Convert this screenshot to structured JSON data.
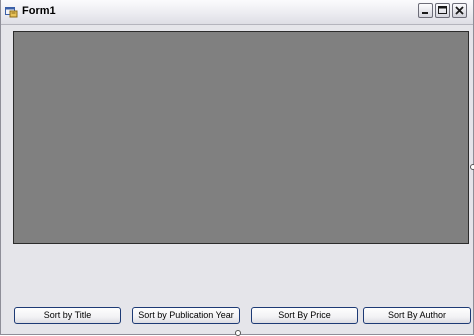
{
  "window": {
    "title": "Form1",
    "icons": {
      "app": "form-app-icon",
      "minimize": "minimize-icon",
      "maximize": "maximize-icon",
      "close": "close-icon"
    }
  },
  "panel": {
    "color": "#808080"
  },
  "buttons": {
    "sort_title": "Sort by Title",
    "sort_year": "Sort by Publication Year",
    "sort_price": "Sort By Price",
    "sort_author": "Sort By Author"
  }
}
